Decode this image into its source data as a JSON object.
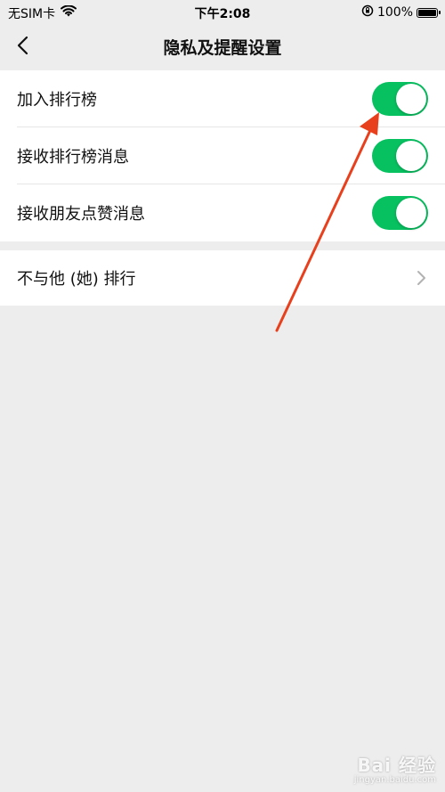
{
  "status_bar": {
    "carrier": "无SIM卡",
    "time": "下午2:08",
    "battery": "100%",
    "wifi_icon": "wifi-icon",
    "lock_icon": "orientation-lock-icon"
  },
  "nav": {
    "back_icon": "chevron-left-icon",
    "title": "隐私及提醒设置"
  },
  "settings": [
    {
      "label": "加入排行榜",
      "toggle": true
    },
    {
      "label": "接收排行榜消息",
      "toggle": true
    },
    {
      "label": "接收朋友点赞消息",
      "toggle": true
    }
  ],
  "links": [
    {
      "label": "不与他 (她) 排行",
      "icon": "chevron-right-icon"
    }
  ],
  "colors": {
    "background": "#ededed",
    "card": "#ffffff",
    "toggle_on": "#07c160",
    "annotation": "#e8401d"
  },
  "watermark": {
    "logo": "Bai 经验",
    "url": "jingyan.baidu.com"
  }
}
